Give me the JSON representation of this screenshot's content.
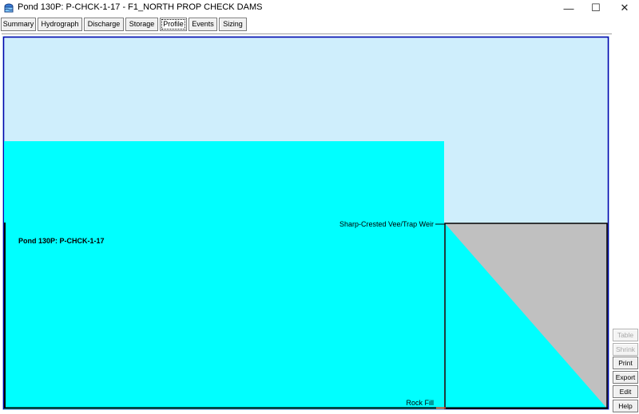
{
  "window": {
    "title": "Pond 130P: P-CHCK-1-17 - F1_NORTH PROP CHECK DAMS",
    "minimize": "—",
    "maximize": "☐",
    "close": "✕"
  },
  "tabs": [
    {
      "label": "Summary",
      "active": false
    },
    {
      "label": "Hydrograph",
      "active": false
    },
    {
      "label": "Discharge",
      "active": false
    },
    {
      "label": "Storage",
      "active": false
    },
    {
      "label": "Profile",
      "active": true
    },
    {
      "label": "Events",
      "active": false
    },
    {
      "label": "Sizing",
      "active": false
    }
  ],
  "profile": {
    "pond_label": "Pond 130P: P-CHCK-1-17",
    "outlet_label": "Sharp-Crested Vee/Trap Weir",
    "base_label": "Rock Fill"
  },
  "colors": {
    "sky": "#cfeefc",
    "water": "#00ffff",
    "weir": "#c0c0c0",
    "frame": "#0000aa",
    "base_marker": "#e04020"
  },
  "side_buttons": [
    {
      "label": "Table",
      "enabled": false
    },
    {
      "label": "Shrink",
      "enabled": false
    },
    {
      "label": "Print",
      "enabled": true
    },
    {
      "label": "Export",
      "enabled": true
    },
    {
      "label": "Edit",
      "enabled": true
    },
    {
      "label": "Help",
      "enabled": true
    }
  ]
}
